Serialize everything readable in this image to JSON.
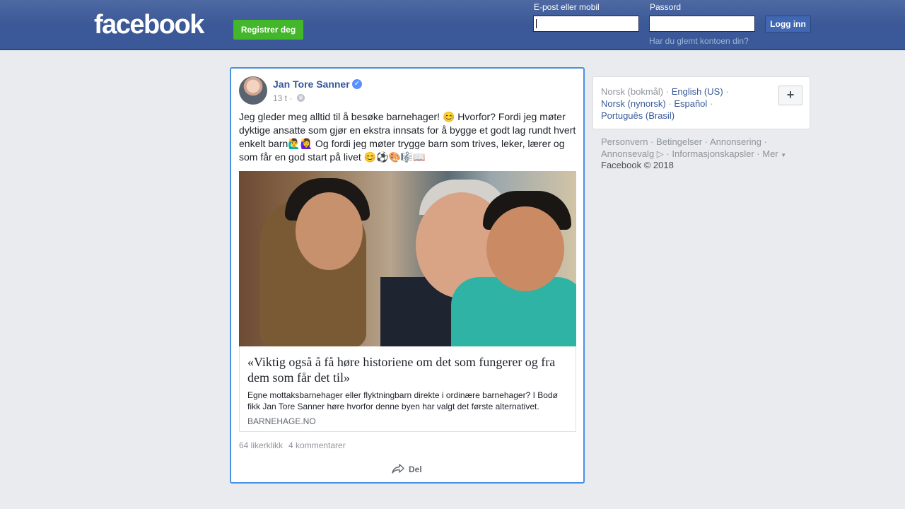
{
  "header": {
    "logo": "facebook",
    "register_label": "Registrer deg",
    "email_label": "E-post eller mobil",
    "email_value": "",
    "password_label": "Passord",
    "password_value": "",
    "login_label": "Logg inn",
    "forgot_label": "Har du glemt kontoen din?"
  },
  "post": {
    "author": "Jan Tore Sanner",
    "time": "13 t ·",
    "text_1": "Jeg gleder meg alltid til å besøke barnehager! 😊 Hvorfor? Fordi jeg møter dyktige ansatte som gjør en ekstra innsats for å bygge et godt lag rundt hvert enkelt barn🙋‍♂️🙋‍♀️ Og fordi jeg møter trygge barn som trives, leker, lærer og som får en god start på livet 😊⚽🎨🎼📖",
    "link_title": "«Viktig også å få høre historiene om det som fungerer og fra dem som får det til»",
    "link_description": "Egne mottaksbarnehager eller flyktningbarn direkte i ordinære barnehager? I Bodø fikk Jan Tore Sanner høre hvorfor denne byen har valgt det første alternativet.",
    "link_domain": "BARNEHAGE.NO",
    "likes": "64 likerklikk",
    "comments": "4 kommentarer",
    "share_label": "Del"
  },
  "languages": {
    "current": "Norsk (bokmål)",
    "sep": " · ",
    "options": [
      "English (US)",
      "Norsk (nynorsk)",
      "Español",
      "Português (Brasil)"
    ],
    "plus": "+"
  },
  "footer": {
    "links": [
      "Personvern",
      "Betingelser",
      "Annonsering",
      "Annonsevalg",
      "Informasjonskapsler",
      "Mer"
    ],
    "copyright": "Facebook © 2018"
  },
  "colors": {
    "header_blue": "#3b5998",
    "register_green": "#42b72a",
    "link_blue": "#365899",
    "focus_border": "#4a90e2"
  }
}
